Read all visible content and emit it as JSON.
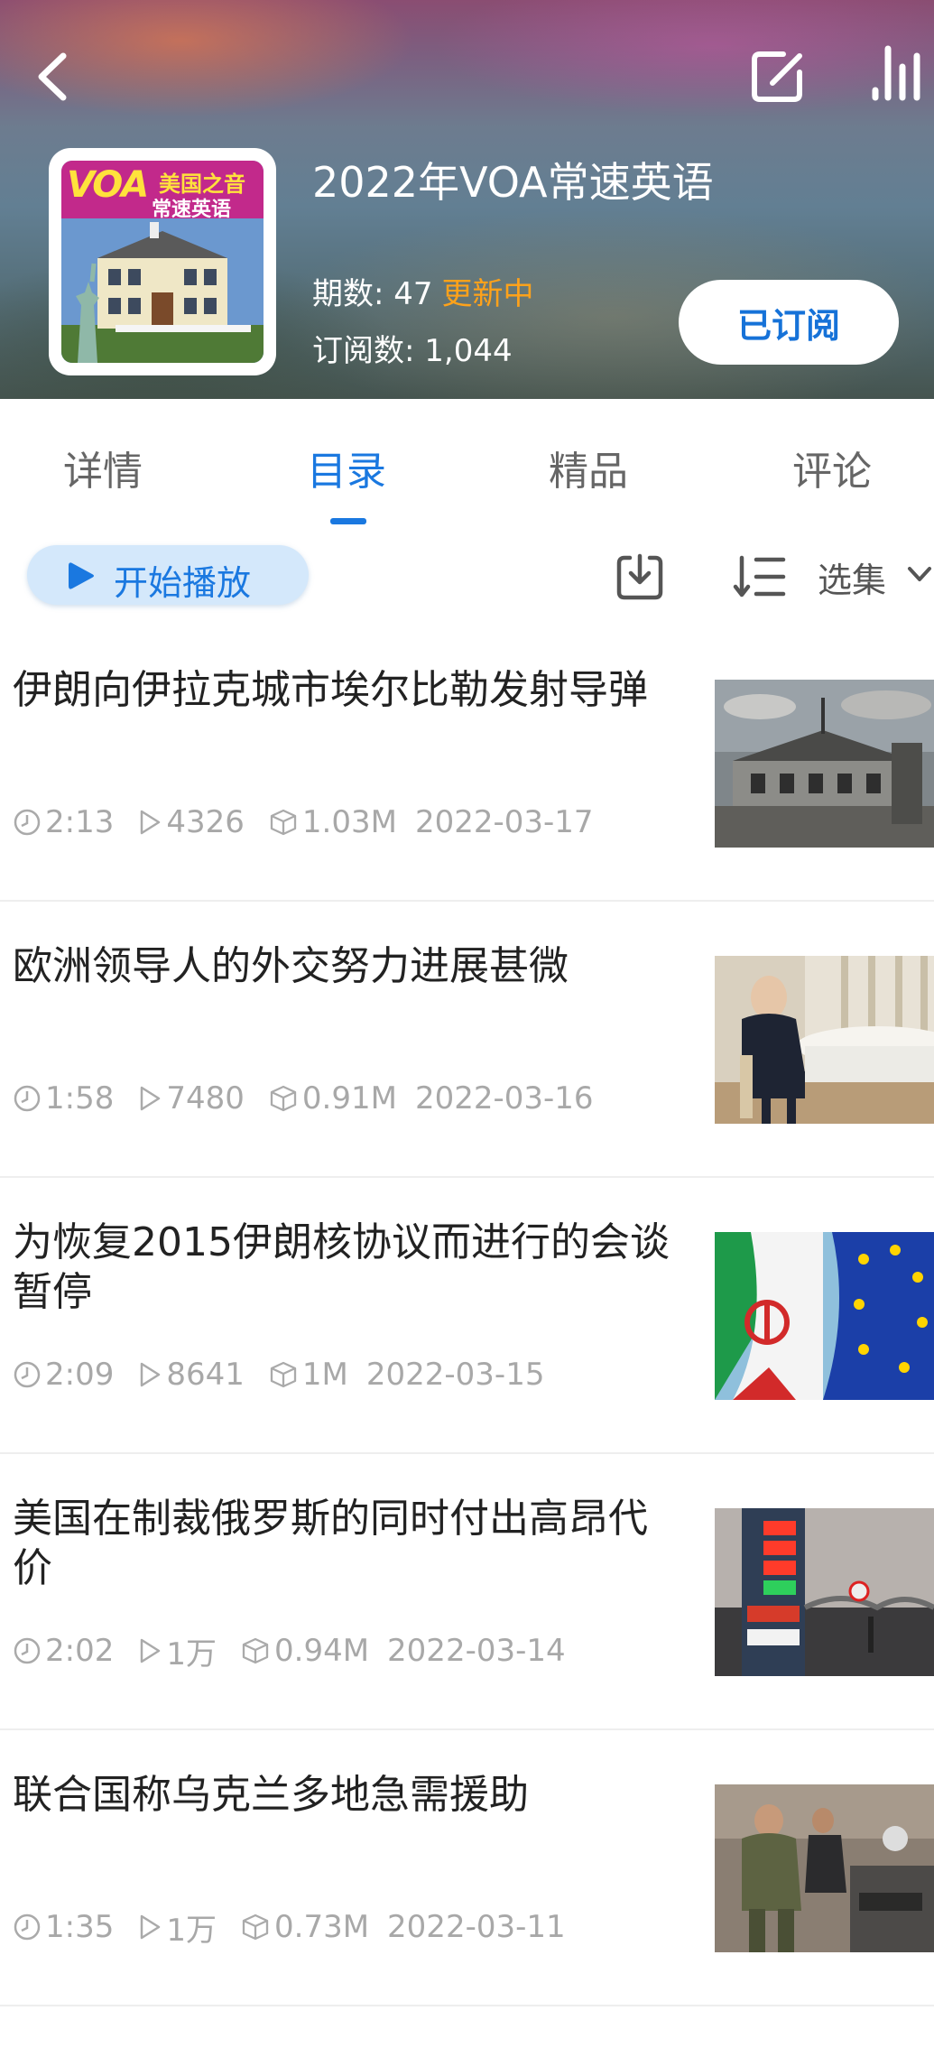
{
  "header": {
    "title": "2022年VOA常速英语",
    "episodes_label": "期数:",
    "episodes_value": "47",
    "updating_badge": "更新中",
    "subscribers_label": "订阅数:",
    "subscribers_value": "1,044",
    "subscribed_button": "已订阅",
    "cover_voa": "VOA",
    "cover_line1": "美国之音",
    "cover_line2": "常速英语"
  },
  "tabs": [
    {
      "label": "详情",
      "active": false
    },
    {
      "label": "目录",
      "active": true
    },
    {
      "label": "精品",
      "active": false
    },
    {
      "label": "评论",
      "active": false
    }
  ],
  "toolbar": {
    "play_all": "开始播放",
    "select": "选集"
  },
  "episodes": [
    {
      "title": "伊朗向伊拉克城市埃尔比勒发射导弹",
      "duration": "2:13",
      "plays": "4326",
      "size": "1.03M",
      "date": "2022-03-17",
      "thumb": "damaged-building"
    },
    {
      "title": "欧洲领导人的外交努力进展甚微",
      "duration": "1:58",
      "plays": "7480",
      "size": "0.91M",
      "date": "2022-03-16",
      "thumb": "meeting-table"
    },
    {
      "title": "为恢复2015伊朗核协议而进行的会谈暂停",
      "duration": "2:09",
      "plays": "8641",
      "size": "1M",
      "date": "2022-03-15",
      "thumb": "iran-eu-flags"
    },
    {
      "title": "美国在制裁俄罗斯的同时付出高昂代价",
      "duration": "2:02",
      "plays": "1万",
      "size": "0.94M",
      "date": "2022-03-14",
      "thumb": "gas-station-prices"
    },
    {
      "title": "联合国称乌克兰多地急需援助",
      "duration": "1:35",
      "plays": "1万",
      "size": "0.73M",
      "date": "2022-03-11",
      "thumb": "field-kitchen"
    }
  ],
  "colors": {
    "accent": "#1a78e0",
    "updating": "#ffa21a",
    "meta_text": "#a8a8a8"
  }
}
